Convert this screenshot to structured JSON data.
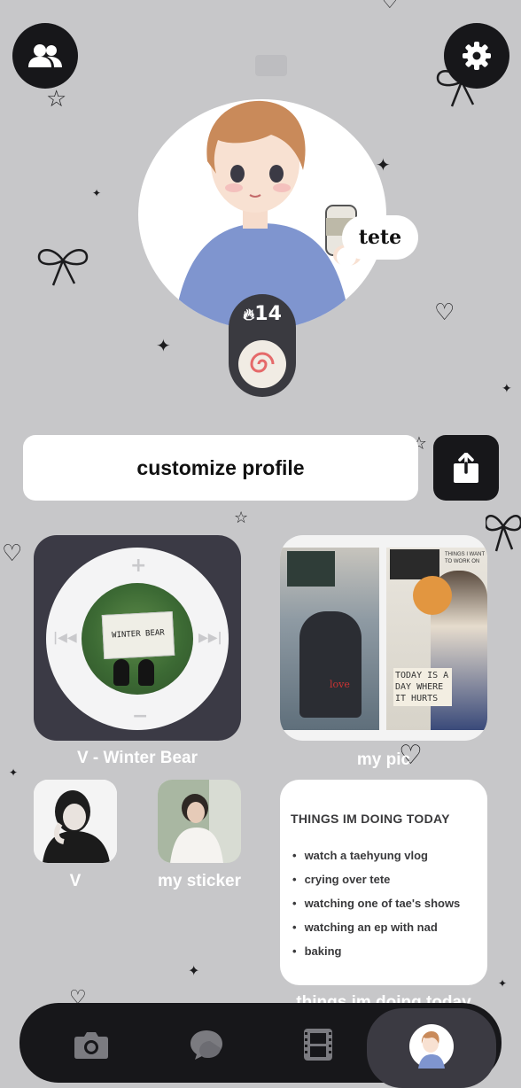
{
  "profile": {
    "name": "tete",
    "streak_count": "14"
  },
  "actions": {
    "customize_label": "customize profile"
  },
  "widgets": {
    "music_label": "V - Winter Bear",
    "album_text": "WINTER BEAR",
    "photo_label": "my pic",
    "photo_texts": [
      "TODAY IS A DAY WHERE IT HURTS",
      "love",
      "THINGS I WANT TO WORK ON"
    ],
    "sticker_v_label": "V",
    "sticker_mine_label": "my sticker",
    "todo_title": "THINGS IM DOING TODAY",
    "todo_items": [
      "watch a taehyung vlog",
      "crying over tete",
      "watching one of tae's shows",
      "watching an ep with nad",
      "baking"
    ],
    "todo_footer": "things im doing today"
  },
  "icons": {
    "friends": "people-icon",
    "settings": "gear-icon",
    "share": "share-icon",
    "camera": "camera-icon",
    "chat": "chat-icon",
    "film": "film-icon"
  },
  "colors": {
    "background": "#c7c7c9",
    "dark": "#17171a",
    "widget_dark": "#3b3a45",
    "white": "#ffffff"
  }
}
